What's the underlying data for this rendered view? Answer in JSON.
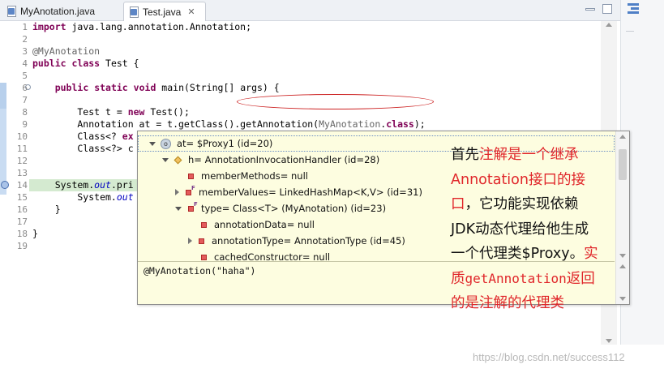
{
  "tabs": [
    {
      "label": "MyAnotation.java",
      "close": ""
    },
    {
      "label": "Test.java",
      "close": "✕"
    }
  ],
  "editor": {
    "lines": [
      {
        "n": "1",
        "tokens": [
          {
            "t": "import",
            "c": "kw"
          },
          {
            "t": " java.lang.annotation.Annotation;",
            "c": ""
          }
        ]
      },
      {
        "n": "2",
        "tokens": []
      },
      {
        "n": "3",
        "tokens": [
          {
            "t": "@MyAnotation",
            "c": "ann"
          }
        ]
      },
      {
        "n": "4",
        "tokens": [
          {
            "t": "public",
            "c": "kw"
          },
          {
            "t": " ",
            "c": ""
          },
          {
            "t": "class",
            "c": "kw"
          },
          {
            "t": " Test {",
            "c": ""
          }
        ]
      },
      {
        "n": "5",
        "tokens": []
      },
      {
        "n": "6",
        "tokens": [
          {
            "t": "    ",
            "c": ""
          },
          {
            "t": "public",
            "c": "kw"
          },
          {
            "t": " ",
            "c": ""
          },
          {
            "t": "static",
            "c": "kw"
          },
          {
            "t": " ",
            "c": ""
          },
          {
            "t": "void",
            "c": "kw"
          },
          {
            "t": " main(String[] args) {",
            "c": ""
          }
        ]
      },
      {
        "n": "7",
        "tokens": []
      },
      {
        "n": "8",
        "tokens": [
          {
            "t": "        Test t = ",
            "c": ""
          },
          {
            "t": "new",
            "c": "kw"
          },
          {
            "t": " Test();",
            "c": ""
          }
        ]
      },
      {
        "n": "9",
        "tokens": [
          {
            "t": "        Annotation at = t.getClass().getAnnotation(",
            "c": ""
          },
          {
            "t": "MyAnotation",
            "c": "ann"
          },
          {
            "t": ".",
            "c": ""
          },
          {
            "t": "class",
            "c": "kw"
          },
          {
            "t": ");",
            "c": ""
          }
        ]
      },
      {
        "n": "10",
        "tokens": [
          {
            "t": "        Class<? ",
            "c": ""
          },
          {
            "t": "ex",
            "c": "kw"
          }
        ]
      },
      {
        "n": "11",
        "tokens": [
          {
            "t": "        Class<?> c",
            "c": ""
          }
        ]
      },
      {
        "n": "12",
        "tokens": []
      },
      {
        "n": "13",
        "tokens": []
      },
      {
        "n": "14",
        "tokens": [
          {
            "t": "    System.",
            "c": ""
          },
          {
            "t": "out",
            "c": "fld"
          },
          {
            "t": ".pri",
            "c": ""
          }
        ]
      },
      {
        "n": "15",
        "tokens": [
          {
            "t": "        System.",
            "c": ""
          },
          {
            "t": "out",
            "c": "fld"
          }
        ]
      },
      {
        "n": "16",
        "tokens": [
          {
            "t": "    }",
            "c": ""
          }
        ]
      },
      {
        "n": "17",
        "tokens": []
      },
      {
        "n": "18",
        "tokens": [
          {
            "t": "}",
            "c": ""
          }
        ]
      },
      {
        "n": "19",
        "tokens": []
      }
    ]
  },
  "popup": {
    "tree": [
      {
        "label": "at= $Proxy1  (id=20)",
        "toggle": "open",
        "icon": "circle",
        "depth": 0
      },
      {
        "label": "h= AnnotationInvocationHandler  (id=28)",
        "toggle": "open",
        "icon": "diamond",
        "depth": 1
      },
      {
        "label": "memberMethods= null",
        "toggle": "",
        "icon": "sq",
        "depth": 2
      },
      {
        "label": "memberValues= LinkedHashMap<K,V>  (id=31)",
        "toggle": "closed",
        "icon": "sqf",
        "depth": 2
      },
      {
        "label": "type= Class<T> (MyAnotation) (id=23)",
        "toggle": "open",
        "icon": "sqf",
        "depth": 2
      },
      {
        "label": "annotationData= null",
        "toggle": "",
        "icon": "sq",
        "depth": 3
      },
      {
        "label": "annotationType= AnnotationType  (id=45)",
        "toggle": "closed",
        "icon": "sq",
        "depth": 3
      },
      {
        "label": "cachedConstructor= null",
        "toggle": "",
        "icon": "sq",
        "depth": 3
      }
    ],
    "value": "@MyAnotation(\"haha\")",
    "root_icon_text": "o"
  },
  "note": {
    "lines": [
      [
        {
          "t": "首先",
          "c": ""
        },
        {
          "t": "注解是一个继承",
          "c": "red"
        }
      ],
      [
        {
          "t": "Annotation接口的接",
          "c": "red"
        }
      ],
      [
        {
          "t": "口",
          "c": "red"
        },
        {
          "t": "，它功能实现依赖",
          "c": ""
        }
      ],
      [
        {
          "t": "JDK动态代理给他生成",
          "c": ""
        }
      ],
      [
        {
          "t": "一个代理类$Proxy。",
          "c": ""
        },
        {
          "t": "实",
          "c": "red"
        }
      ],
      [
        {
          "t": "质",
          "c": "red"
        },
        {
          "t": "getAnnotation",
          "c": "red mono"
        },
        {
          "t": "返回",
          "c": "red"
        }
      ],
      [
        {
          "t": "的是注解的代理类",
          "c": "red"
        }
      ]
    ]
  },
  "watermark": "https://blog.csdn.net/success112"
}
